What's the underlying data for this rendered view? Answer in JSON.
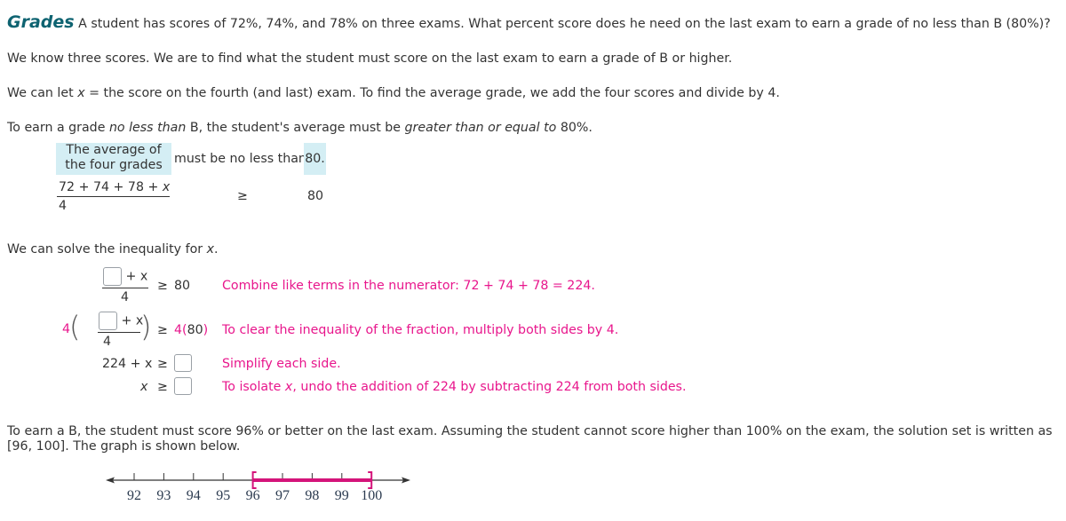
{
  "problem": {
    "title": "Grades",
    "statement": "A student has scores of 72%, 74%, and 78% on three exams. What percent score does he need on the last exam to earn a grade of no less than B (80%)?"
  },
  "paragraphs": {
    "p1": "We know three scores. We are to find what the student must score on the last exam to earn a grade of B or higher.",
    "p2_before": "We can let ",
    "p2_var": "x",
    "p2_after": " = the score on the fourth (and last) exam. To find the average grade, we add the four scores and divide by 4.",
    "p3_a": "To earn a grade ",
    "p3_em1": "no less than",
    "p3_b": " B, the student's average must be ",
    "p3_em2": "greater than or equal to",
    "p3_c": " 80%."
  },
  "translation": {
    "phrase1_line1": "The average of",
    "phrase1_line2": "the four grades",
    "phrase2": "must be no less than",
    "phrase3": "80.",
    "numerator": "72 + 74 + 78 + ",
    "numerator_var": "x",
    "denominator": "4",
    "relation": "≥",
    "rhs": "80"
  },
  "solve": {
    "intro_before": "We can solve the inequality for ",
    "intro_var": "x",
    "intro_after": ".",
    "steps": [
      {
        "numerator_suffix": "+ x",
        "denominator": "4",
        "relation": "≥",
        "rhs": "80",
        "input_value": "",
        "note": "Combine like terms in the numerator: 72 + 74 + 78 = 224."
      },
      {
        "multiplier": "4",
        "numerator_suffix": "+ x",
        "denominator": "4",
        "relation": "≥",
        "rhs_multiplier": "4",
        "rhs_value": "80",
        "input_value": "",
        "note": "To clear the inequality of the fraction, multiply both sides by 4."
      },
      {
        "lhs": "224 + x",
        "relation": "≥",
        "input_value": "",
        "note": "Simplify each side."
      },
      {
        "lhs": "x",
        "relation": "≥",
        "input_value": "",
        "note_before": "To isolate ",
        "note_var": "x",
        "note_after": ", undo the addition of 224 by subtracting 224 from both sides."
      }
    ]
  },
  "conclusion": {
    "line1": "To earn a B, the student must score 96% or better on the last exam. Assuming the student cannot score higher than 100% on the exam, the solution set is written as",
    "line2": "[96, 100]. The graph is shown below."
  },
  "number_line": {
    "ticks": [
      "92",
      "93",
      "94",
      "95",
      "96",
      "97",
      "98",
      "99",
      "100"
    ],
    "interval_start": 96,
    "interval_end": 100,
    "start_bracket": "[",
    "end_bracket": "]",
    "highlight_color": "#d4147a",
    "axis_color": "#333333"
  },
  "colors": {
    "title": "#0e6371",
    "note": "#e8168c",
    "highlight": "#d4eef4"
  }
}
